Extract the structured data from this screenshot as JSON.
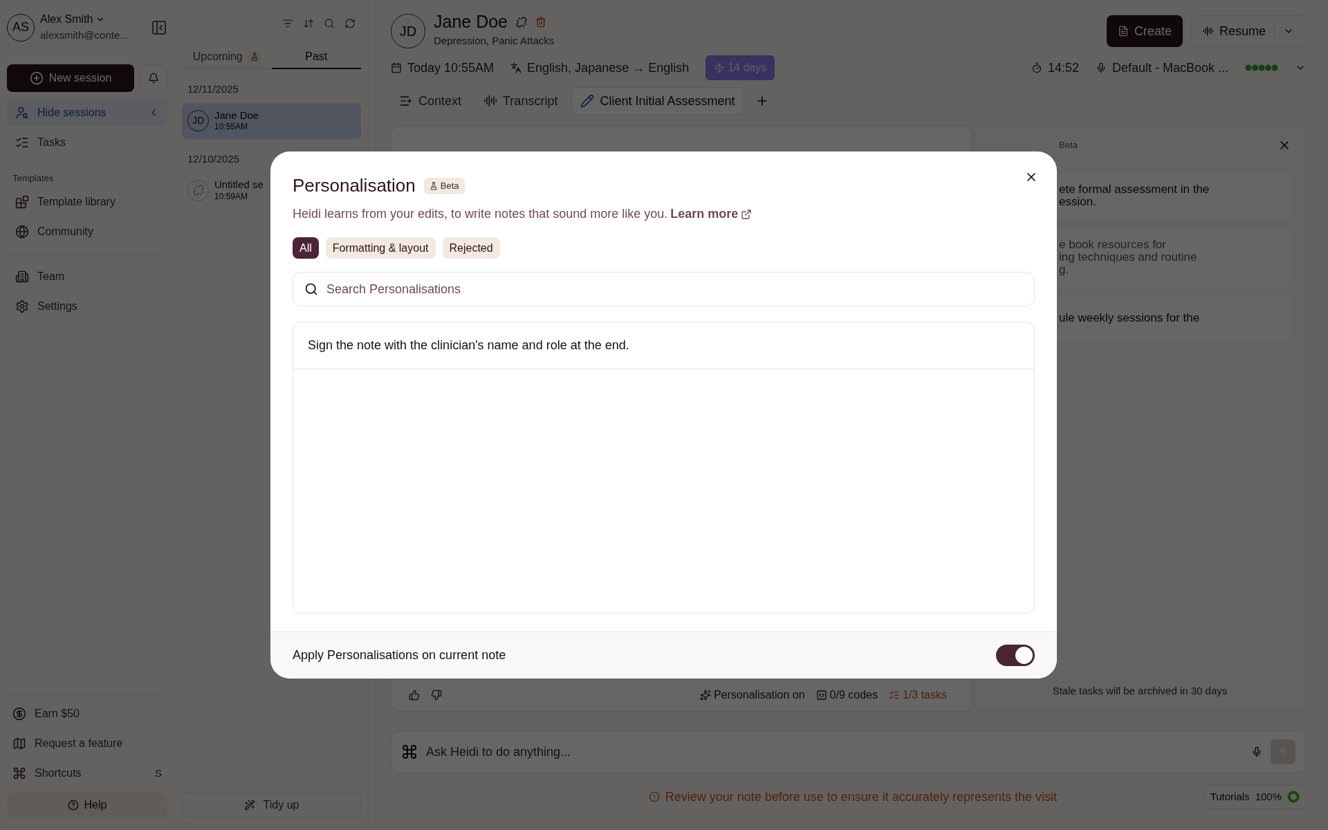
{
  "sidebar": {
    "user": {
      "initials": "AS",
      "name": "Alex Smith",
      "email": "alexsmith@conte..."
    },
    "new_session": "New session",
    "nav": [
      {
        "label": "Hide sessions",
        "selected": true,
        "kind": "sessions"
      },
      {
        "label": "Tasks",
        "selected": false,
        "kind": "tasks"
      }
    ],
    "templates_heading": "Templates",
    "template_items": [
      {
        "label": "Template library",
        "kind": "library"
      },
      {
        "label": "Community",
        "kind": "community"
      }
    ],
    "org_items": [
      {
        "label": "Team",
        "kind": "team"
      },
      {
        "label": "Settings",
        "kind": "settings"
      }
    ],
    "footer_items": [
      {
        "label": "Earn $50",
        "kind": "earn"
      },
      {
        "label": "Request a feature",
        "kind": "feature"
      },
      {
        "label": "Shortcuts",
        "kind": "shortcuts",
        "shortcut": "S"
      }
    ],
    "help": "Help"
  },
  "sessions": {
    "tabs": [
      {
        "label": "Upcoming",
        "selected": false,
        "beta": true
      },
      {
        "label": "Past",
        "selected": true,
        "beta": false
      }
    ],
    "groups": [
      {
        "date": "12/11/2025",
        "items": [
          {
            "kind": "initials",
            "initials": "JD",
            "name": "Jane Doe",
            "time": "10:55AM",
            "selected": true
          }
        ]
      },
      {
        "date": "12/10/2025",
        "items": [
          {
            "kind": "unlinked",
            "name": "Untitled se",
            "time": "10:59AM",
            "selected": false
          }
        ]
      }
    ],
    "tidy_up": "Tidy up"
  },
  "session": {
    "initials": "JD",
    "name": "Jane Doe",
    "subtitle": "Depression, Panic Attacks",
    "create": "Create",
    "resume": "Resume",
    "date": "Today 10:55AM",
    "languages": "English, Japanese → English",
    "trial": "14 days",
    "timer": "14:52",
    "mic": "Default - MacBook ...",
    "tabs": [
      {
        "label": "Context",
        "selected": false,
        "kind": "context"
      },
      {
        "label": "Transcript",
        "selected": false,
        "kind": "transcript"
      },
      {
        "label": "Client Initial Assessment",
        "selected": true,
        "kind": "note"
      }
    ]
  },
  "note_footer": {
    "personalisation": "Personalisation on",
    "codes": "0/9 codes",
    "tasks": "1/3 tasks"
  },
  "tasks_panel": {
    "badge": "Beta",
    "items": [
      {
        "lines": [
          "ete formal assessment in the",
          "ession."
        ],
        "done": false
      },
      {
        "lines": [
          "e book resources for",
          "ing techniques and routine",
          "g."
        ],
        "done": true
      },
      {
        "lines": [
          "ule weekly sessions for the"
        ],
        "done": false
      }
    ],
    "note": "Stale tasks will be archived in 30 days"
  },
  "ask": {
    "placeholder": "Ask Heidi to do anything..."
  },
  "warning": "Review your note before use to ensure it accurately represents the visit",
  "tutorials": {
    "label": "Tutorials",
    "percent": "100%",
    "level": 1
  },
  "modal": {
    "title": "Personalisation",
    "badge": "Beta",
    "description": "Heidi learns from your edits, to write notes that sound more like you.",
    "link": "Learn more",
    "filters": [
      {
        "label": "All",
        "selected": true
      },
      {
        "label": "Formatting & layout",
        "selected": false
      },
      {
        "label": "Rejected",
        "selected": false
      }
    ],
    "search": {
      "placeholder": "Search Personalisations"
    },
    "items": [
      "Sign the note with the clinician's name and role at the end."
    ],
    "apply": {
      "label": "Apply Personalisations on current note",
      "on": true
    }
  }
}
